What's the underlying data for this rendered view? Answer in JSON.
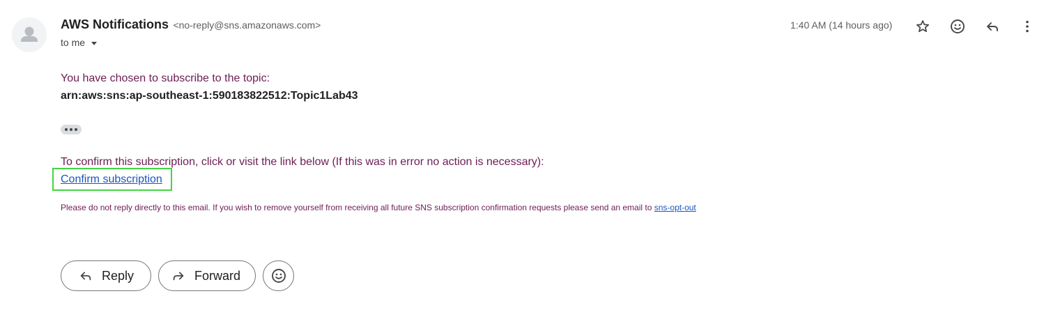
{
  "header": {
    "sender_name": "AWS Notifications",
    "sender_email": "<no-reply@sns.amazonaws.com>",
    "recipient": "to me",
    "timestamp": "1:40 AM (14 hours ago)",
    "icons": [
      "avatar-icon",
      "chevron-down-icon",
      "star-icon",
      "emoji-icon",
      "reply-icon",
      "more-vert-icon"
    ]
  },
  "message": {
    "line1": "You have chosen to subscribe to the topic:",
    "arn": "arn:aws:sns:ap-southeast-1:590183822512:Topic1Lab43",
    "line3": "To confirm this subscription, click or visit the link below (If this was in error no action is necessary):",
    "confirm_link": "Confirm subscription",
    "footer_note": "Please do not reply directly to this email. If you wish to remove yourself from receiving all future SNS subscription confirmation requests please send an email to ",
    "opt_out_link": "sns-opt-out"
  },
  "actions": {
    "reply_label": "Reply",
    "forward_label": "Forward"
  },
  "colors": {
    "body_text": "#6c1d54",
    "link": "#1a56c4",
    "highlight": "#44d444"
  }
}
